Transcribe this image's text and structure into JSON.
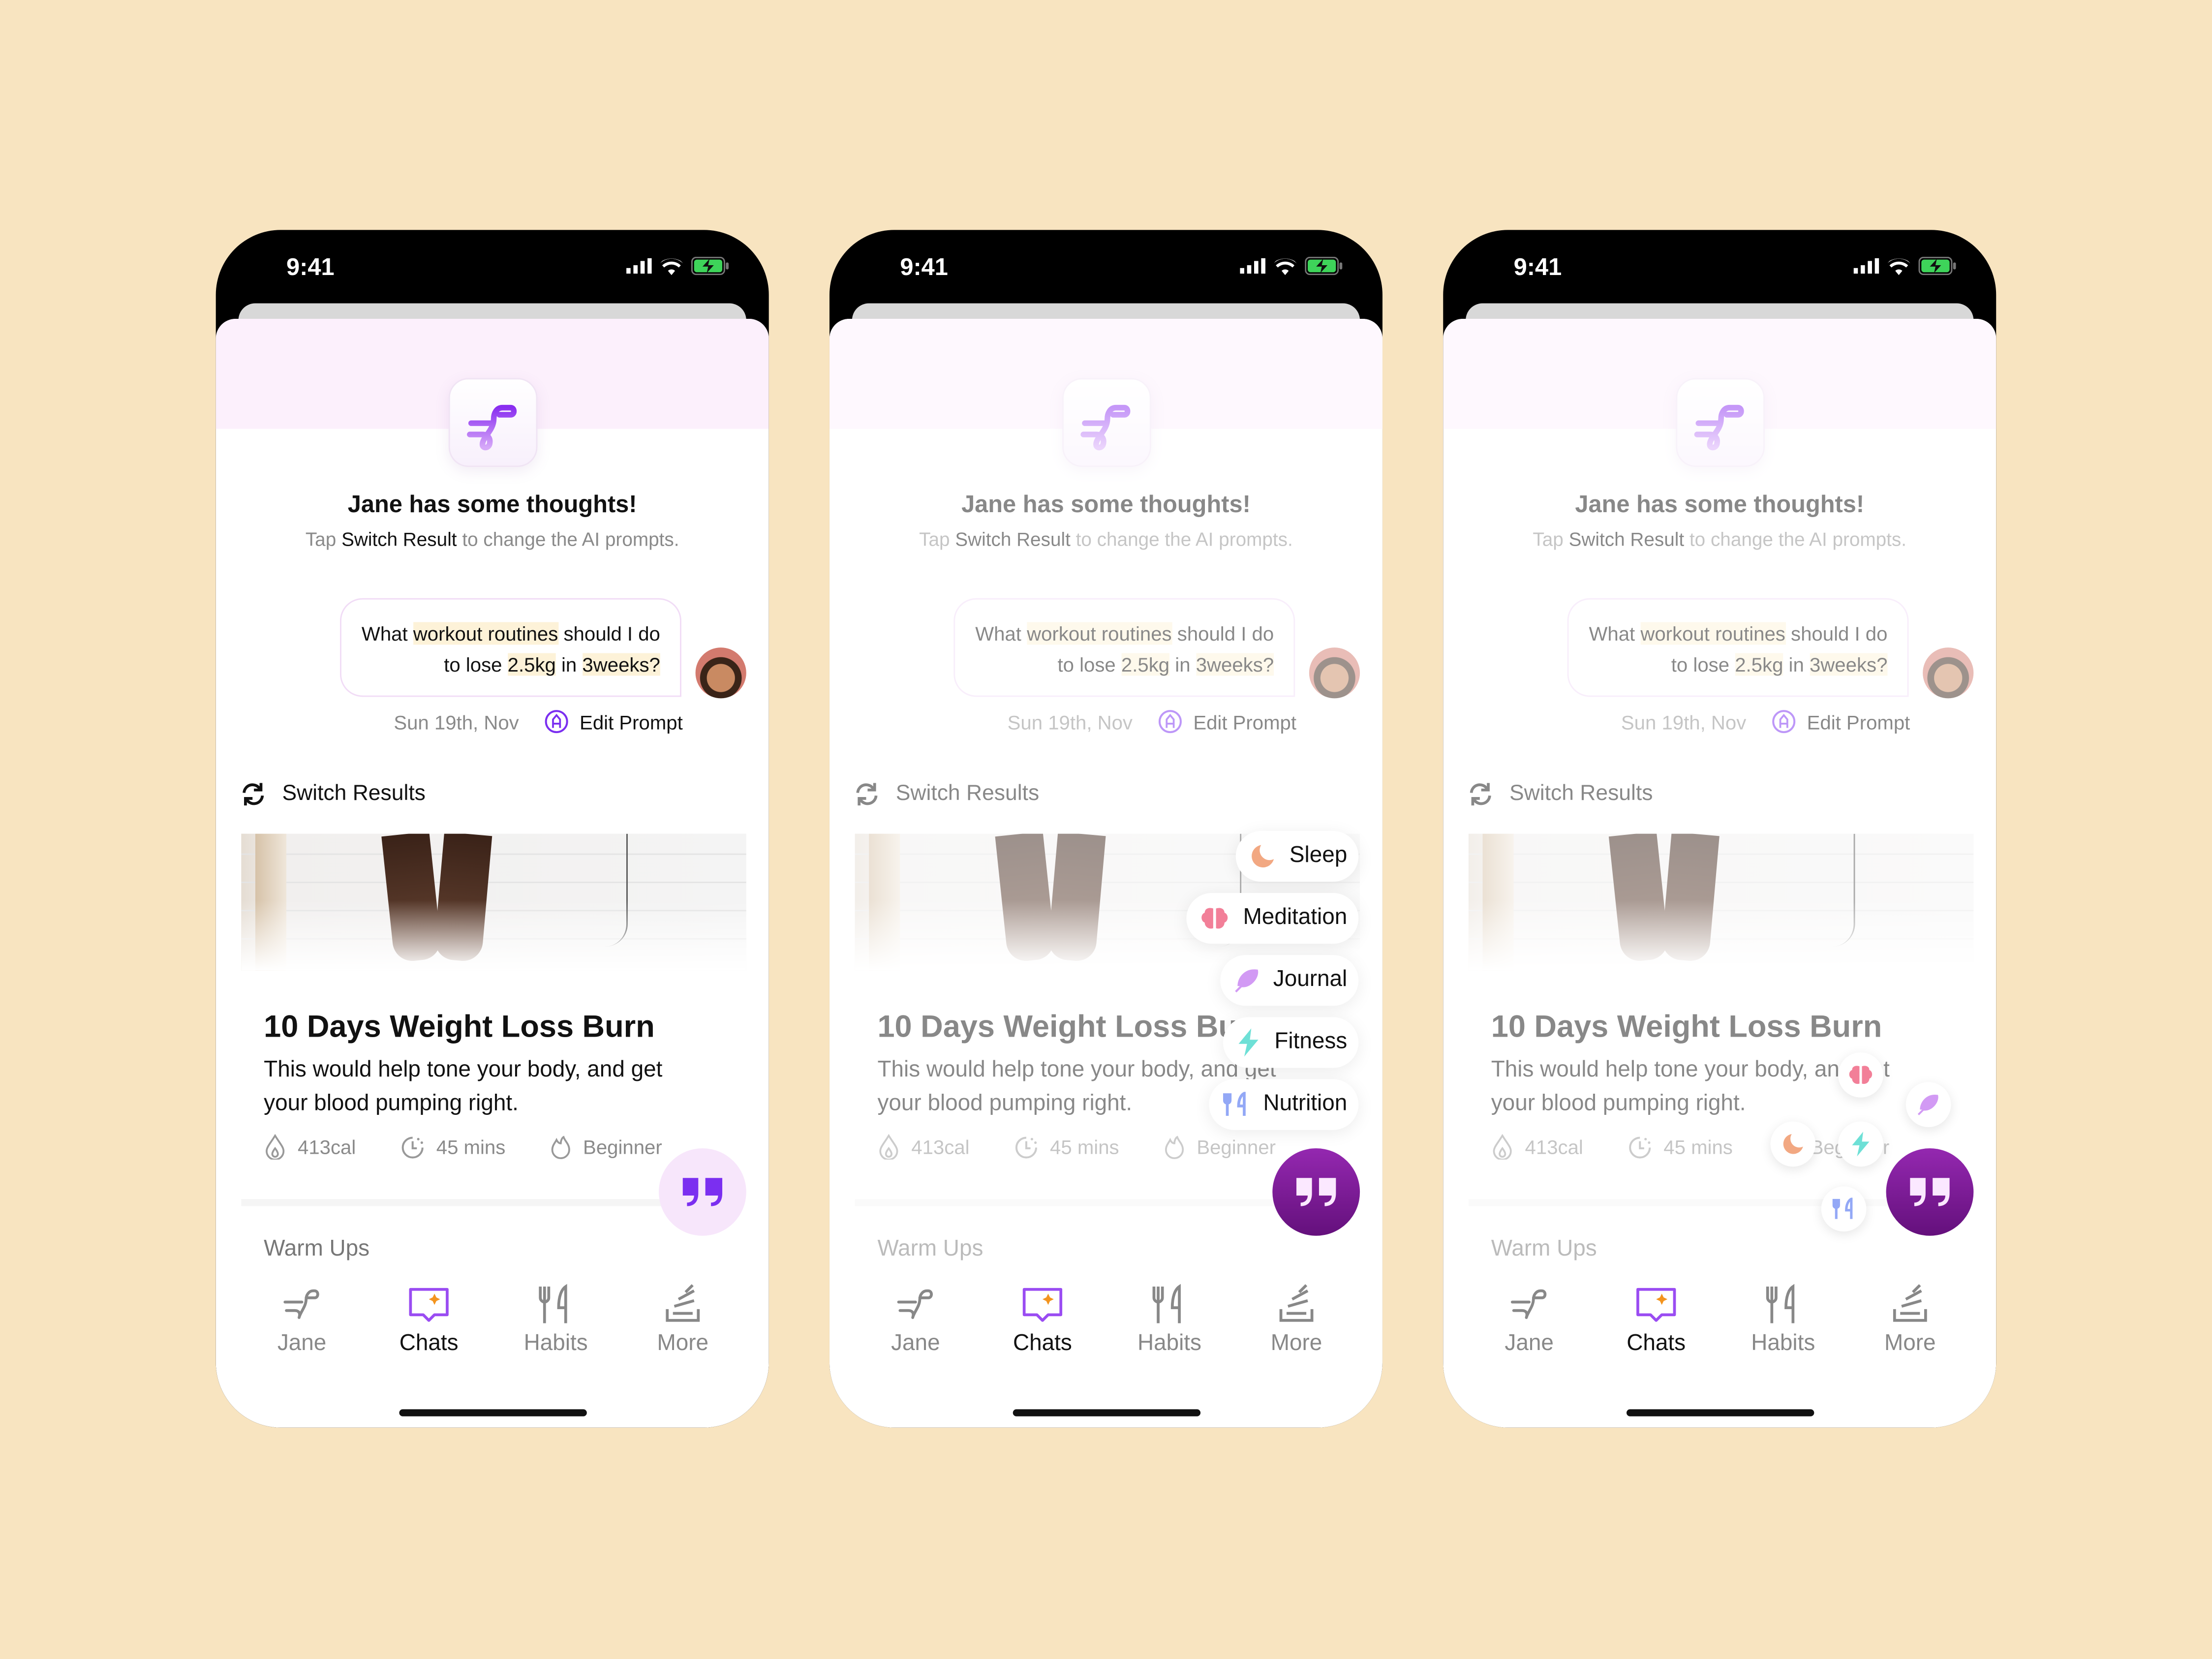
{
  "status_bar": {
    "time": "9:41",
    "icons": [
      "signal-icon",
      "wifi-icon",
      "battery-charging-icon"
    ]
  },
  "phones": [
    {
      "variant": "default"
    },
    {
      "variant": "menu"
    },
    {
      "variant": "arc"
    }
  ],
  "header": {
    "title": "Jane has some thoughts!",
    "subtitle_pre": "Tap",
    "subtitle_bold": "Switch Result",
    "subtitle_post": "to change the AI prompts."
  },
  "prompt": {
    "parts": [
      "What ",
      "workout routines",
      " should I do",
      "to lose ",
      "2.5kg",
      " in ",
      "3weeks?"
    ],
    "date": "Sun 19th, Nov",
    "edit_label": "Edit Prompt"
  },
  "switch_label": "Switch Results",
  "workout": {
    "title": "10 Days Weight Loss Burn",
    "description": "This would help tone your body, and get your blood pumping right.",
    "calories": "413cal",
    "duration": "45 mins",
    "level": "Beginner"
  },
  "section_label": "Warm Ups",
  "tabs": [
    {
      "label": "Jane",
      "icon": "jane-logo-icon",
      "active": false
    },
    {
      "label": "Chats",
      "icon": "chat-sparkle-icon",
      "active": true
    },
    {
      "label": "Habits",
      "icon": "fork-knife-icon",
      "active": false
    },
    {
      "label": "More",
      "icon": "stack-icon",
      "active": false
    }
  ],
  "menu": [
    {
      "label": "Sleep",
      "icon": "moon-icon",
      "color": "#f2a882"
    },
    {
      "label": "Meditation",
      "icon": "brain-icon",
      "color": "#f27f98"
    },
    {
      "label": "Journal",
      "icon": "feather-icon",
      "color": "#d29af4"
    },
    {
      "label": "Fitness",
      "icon": "lightning-icon",
      "color": "#6ee0d6"
    },
    {
      "label": "Nutrition",
      "icon": "fork-knife-icon",
      "color": "#93a8f6"
    }
  ],
  "colors": {
    "background": "#f8e4c0",
    "accent": "#7b2ff0",
    "fab_active": "#7a1a94"
  }
}
